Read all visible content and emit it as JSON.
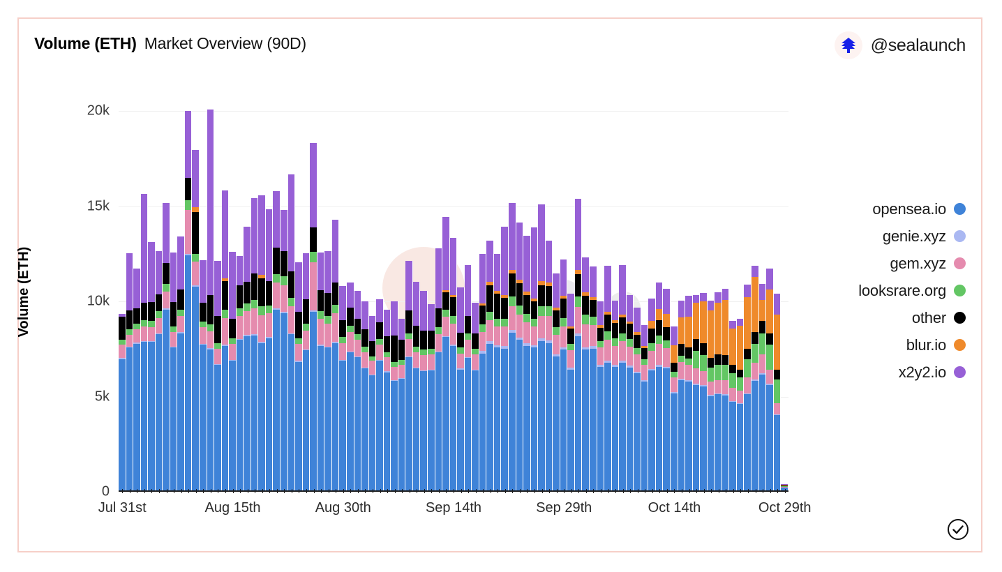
{
  "header": {
    "title_main": "Volume (ETH)",
    "title_sub": "Market Overview (90D)",
    "brand_handle": "@sealaunch",
    "brand_logo_icon": "sealaunch-logo-icon"
  },
  "footer": {
    "verified_icon": "circled-check-icon"
  },
  "theme": {
    "card_border": "#f6cfc8",
    "background": "#ffffff",
    "gridline": "#f0f0f0",
    "axis": "#1d1d1d",
    "text": "#1a1a1a"
  },
  "legend": {
    "position": "right",
    "items": [
      {
        "label": "opensea.io",
        "color": "#3f83d8",
        "key": "opensea"
      },
      {
        "label": "genie.xyz",
        "color": "#aab8f2",
        "key": "genie"
      },
      {
        "label": "gem.xyz",
        "color": "#e58bae",
        "key": "gem"
      },
      {
        "label": "looksrare.org",
        "color": "#63c664",
        "key": "looksrare"
      },
      {
        "label": "other",
        "color": "#000000",
        "key": "other"
      },
      {
        "label": "blur.io",
        "color": "#ef8a2b",
        "key": "blur"
      },
      {
        "label": "x2y2.io",
        "color": "#9760d6",
        "key": "x2y2"
      }
    ]
  },
  "chart_data": {
    "type": "bar",
    "stacked": true,
    "title": "Volume (ETH) Market Overview (90D)",
    "xlabel": "",
    "ylabel": "Volume (ETH)",
    "ylim": [
      0,
      21000
    ],
    "yticks": [
      0,
      5000,
      10000,
      15000,
      20000
    ],
    "ytick_labels": [
      "0",
      "5k",
      "10k",
      "15k",
      "20k"
    ],
    "grid": true,
    "xtick_labels": [
      "Jul 31st",
      "Aug 15th",
      "Aug 30th",
      "Sep 14th",
      "Sep 29th",
      "Oct 14th",
      "Oct 29th"
    ],
    "xtick_indices": [
      0,
      15,
      30,
      45,
      60,
      75,
      90
    ],
    "categories": [
      "Jul 31st",
      "Aug 1st",
      "Aug 2nd",
      "Aug 3rd",
      "Aug 4th",
      "Aug 5th",
      "Aug 6th",
      "Aug 7th",
      "Aug 8th",
      "Aug 9th",
      "Aug 10th",
      "Aug 11th",
      "Aug 12th",
      "Aug 13th",
      "Aug 14th",
      "Aug 15th",
      "Aug 16th",
      "Aug 17th",
      "Aug 18th",
      "Aug 19th",
      "Aug 20th",
      "Aug 21st",
      "Aug 22nd",
      "Aug 23rd",
      "Aug 24th",
      "Aug 25th",
      "Aug 26th",
      "Aug 27th",
      "Aug 28th",
      "Aug 29th",
      "Aug 30th",
      "Aug 31st",
      "Sep 1st",
      "Sep 2nd",
      "Sep 3rd",
      "Sep 4th",
      "Sep 5th",
      "Sep 6th",
      "Sep 7th",
      "Sep 8th",
      "Sep 9th",
      "Sep 10th",
      "Sep 11th",
      "Sep 12th",
      "Sep 13th",
      "Sep 14th",
      "Sep 15th",
      "Sep 16th",
      "Sep 17th",
      "Sep 18th",
      "Sep 19th",
      "Sep 20th",
      "Sep 21st",
      "Sep 22nd",
      "Sep 23rd",
      "Sep 24th",
      "Sep 25th",
      "Sep 26th",
      "Sep 27th",
      "Sep 28th",
      "Sep 29th",
      "Sep 30th",
      "Oct 1st",
      "Oct 2nd",
      "Oct 3rd",
      "Oct 4th",
      "Oct 5th",
      "Oct 6th",
      "Oct 7th",
      "Oct 8th",
      "Oct 9th",
      "Oct 10th",
      "Oct 11th",
      "Oct 12th",
      "Oct 13th",
      "Oct 14th",
      "Oct 15th",
      "Oct 16th",
      "Oct 17th",
      "Oct 18th",
      "Oct 19th",
      "Oct 20th",
      "Oct 21st",
      "Oct 22nd",
      "Oct 23rd",
      "Oct 24th",
      "Oct 25th",
      "Oct 26th",
      "Oct 27th",
      "Oct 28th",
      "Oct 29th"
    ],
    "series": [
      {
        "name": "opensea.io",
        "color": "#3f83d8",
        "values": [
          6900,
          7500,
          7700,
          7800,
          7800,
          8200,
          9500,
          7500,
          8250,
          12350,
          10700,
          7650,
          7400,
          6600,
          7600,
          6800,
          7900,
          8100,
          8150,
          7750,
          8000,
          9500,
          9300,
          8200,
          6750,
          7350,
          9400,
          7600,
          7500,
          7750,
          6800,
          7250,
          7000,
          6400,
          6050,
          6800,
          6200,
          5750,
          5850,
          7000,
          6400,
          6250,
          6300,
          7250,
          8050,
          7600,
          6350,
          6950,
          6300,
          7200,
          7700,
          7500,
          7450,
          8300,
          7900,
          7600,
          7500,
          7850,
          7750,
          7050,
          7400,
          6350,
          8100,
          7400,
          7450,
          6500,
          6700,
          6500,
          6700,
          6450,
          6150,
          5700,
          6300,
          6500,
          6400,
          5100,
          5800,
          5700,
          5550,
          5450,
          4950,
          5050,
          5000,
          4650,
          4550,
          5050,
          5750,
          6100,
          5550,
          3950,
          150
        ]
      },
      {
        "name": "genie.xyz",
        "color": "#aab8f2",
        "values": [
          60,
          60,
          60,
          60,
          60,
          60,
          60,
          60,
          60,
          80,
          70,
          60,
          60,
          50,
          60,
          50,
          60,
          60,
          60,
          60,
          60,
          70,
          70,
          60,
          50,
          60,
          70,
          60,
          60,
          60,
          50,
          60,
          50,
          50,
          50,
          50,
          50,
          50,
          50,
          50,
          50,
          50,
          50,
          60,
          60,
          60,
          50,
          50,
          50,
          120,
          130,
          120,
          120,
          140,
          130,
          120,
          120,
          130,
          130,
          110,
          120,
          100,
          130,
          120,
          120,
          100,
          100,
          100,
          100,
          100,
          90,
          80,
          90,
          90,
          90,
          70,
          80,
          80,
          70,
          70,
          60,
          60,
          60,
          50,
          50,
          50,
          60,
          60,
          50,
          40,
          5
        ]
      },
      {
        "name": "gem.xyz",
        "color": "#e58bae",
        "values": [
          700,
          600,
          700,
          750,
          700,
          800,
          900,
          750,
          850,
          2300,
          1250,
          850,
          900,
          800,
          1400,
          850,
          1200,
          1250,
          1350,
          1400,
          1250,
          1350,
          1400,
          1400,
          900,
          1000,
          2500,
          1350,
          1200,
          1500,
          900,
          1000,
          850,
          800,
          700,
          800,
          750,
          700,
          700,
          900,
          800,
          800,
          800,
          900,
          1000,
          1100,
          800,
          900,
          800,
          1000,
          1100,
          1000,
          1050,
          1250,
          1200,
          1100,
          1000,
          1200,
          1300,
          1000,
          1100,
          900,
          1400,
          1200,
          1100,
          900,
          1100,
          1000,
          1050,
          1000,
          900,
          800,
          950,
          1100,
          1000,
          750,
          850,
          800,
          800,
          750,
          700,
          700,
          750,
          700,
          650,
          850,
          900,
          1000,
          750,
          600,
          30
        ]
      },
      {
        "name": "looksrare.org",
        "color": "#63c664",
        "values": [
          250,
          300,
          300,
          350,
          350,
          350,
          400,
          300,
          350,
          500,
          400,
          300,
          350,
          300,
          450,
          300,
          400,
          400,
          450,
          450,
          400,
          450,
          500,
          450,
          300,
          350,
          550,
          400,
          400,
          450,
          300,
          350,
          300,
          300,
          250,
          300,
          250,
          250,
          250,
          300,
          300,
          300,
          300,
          350,
          400,
          400,
          300,
          350,
          300,
          400,
          450,
          400,
          400,
          500,
          500,
          450,
          400,
          500,
          500,
          400,
          450,
          350,
          550,
          500,
          450,
          350,
          450,
          400,
          400,
          400,
          350,
          300,
          400,
          450,
          400,
          300,
          350,
          350,
          900,
          850,
          750,
          800,
          800,
          750,
          700,
          950,
          1000,
          1100,
          1300,
          1250,
          40
        ]
      },
      {
        "name": "other",
        "color": "#000000",
        "values": [
          1200,
          1000,
          800,
          900,
          1000,
          900,
          1100,
          1300,
          1050,
          1200,
          2200,
          1000,
          1550,
          1400,
          1500,
          1000,
          1200,
          1150,
          1400,
          1500,
          1300,
          1400,
          1300,
          1400,
          1400,
          1300,
          1300,
          1100,
          1200,
          1150,
          900,
          950,
          800,
          900,
          800,
          900,
          850,
          1400,
          1050,
          1200,
          1100,
          1000,
          950,
          1000,
          900,
          1000,
          800,
          900,
          800,
          1000,
          1400,
          1300,
          1100,
          1200,
          1150,
          1000,
          900,
          1100,
          1050,
          900,
          1000,
          800,
          1200,
          1000,
          900,
          700,
          900,
          800,
          850,
          800,
          700,
          600,
          750,
          800,
          700,
          500,
          600,
          600,
          650,
          600,
          500,
          550,
          500,
          450,
          400,
          550,
          600,
          650,
          600,
          500,
          20
        ]
      },
      {
        "name": "blur.io",
        "color": "#ef8a2b",
        "values": [
          0,
          0,
          0,
          0,
          0,
          0,
          0,
          0,
          0,
          0,
          250,
          0,
          0,
          0,
          120,
          0,
          0,
          0,
          0,
          150,
          0,
          0,
          0,
          0,
          0,
          0,
          0,
          0,
          0,
          0,
          0,
          0,
          0,
          0,
          0,
          0,
          0,
          0,
          0,
          0,
          0,
          0,
          0,
          0,
          120,
          100,
          0,
          0,
          0,
          100,
          180,
          150,
          150,
          200,
          180,
          160,
          150,
          200,
          180,
          150,
          160,
          120,
          200,
          180,
          150,
          120,
          150,
          130,
          140,
          130,
          120,
          100,
          400,
          600,
          700,
          900,
          1400,
          1600,
          1900,
          2200,
          2500,
          2700,
          2900,
          1900,
          2300,
          2700,
          2900,
          1100,
          2300,
          2900,
          60
        ]
      },
      {
        "name": "x2y2.io",
        "color": "#9760d6",
        "values": [
          150,
          3000,
          2100,
          5700,
          3150,
          2250,
          3150,
          2600,
          2800,
          3500,
          3000,
          2250,
          9750,
          2900,
          4650,
          3550,
          1550,
          2900,
          3950,
          4200,
          3750,
          2950,
          2150,
          5100,
          2600,
          2400,
          4450,
          2000,
          2200,
          3300,
          1800,
          1300,
          1500,
          1500,
          1300,
          1200,
          1400,
          1800,
          1100,
          2600,
          2300,
          2100,
          1400,
          3150,
          3850,
          3000,
          2350,
          2700,
          1600,
          2600,
          2150,
          1950,
          3600,
          3500,
          3000,
          2950,
          3750,
          4050,
          2200,
          1800,
          1900,
          1700,
          3750,
          1850,
          1600,
          1250,
          2400,
          1050,
          2600,
          1400,
          1300,
          1100,
          1200,
          1400,
          1300,
          1000,
          900,
          1100,
          400,
          450,
          500,
          550,
          600,
          400,
          350,
          650,
          600,
          850,
          1100,
          1100,
          30
        ]
      }
    ]
  }
}
